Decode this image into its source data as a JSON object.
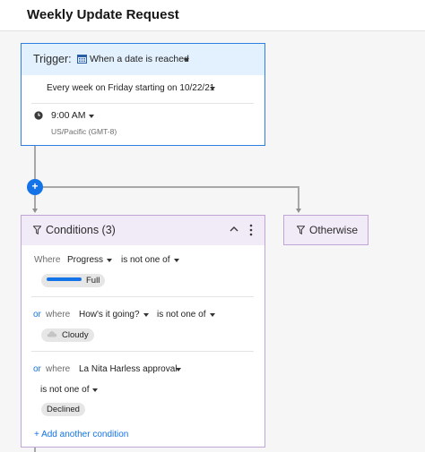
{
  "page": {
    "title": "Weekly Update Request"
  },
  "trigger": {
    "label": "Trigger:",
    "type_label": "When a date is reached",
    "type_icon": "calendar-icon",
    "schedule": "Every week on Friday starting on 10/22/21",
    "time": "9:00 AM",
    "time_icon": "clock-icon",
    "timezone": "US/Pacific (GMT-8)"
  },
  "add_button": {
    "label": "+"
  },
  "conditions": {
    "title": "Conditions (3)",
    "rows": [
      {
        "connector": "",
        "where": "Where",
        "field": "Progress",
        "operator": "is not one of",
        "value": "Full"
      },
      {
        "connector": "or",
        "where": "where",
        "field": "How's it going?",
        "operator": "is not one of",
        "value": "Cloudy"
      },
      {
        "connector": "or",
        "where": "where",
        "field": "La Nita Harless approval",
        "operator": "is not one of",
        "value": "Declined"
      }
    ],
    "add_label": "+ Add another condition"
  },
  "otherwise": {
    "label": "Otherwise"
  },
  "colors": {
    "accent": "#1473e6",
    "trigger_border": "#2d7fe0",
    "trigger_header": "#e3f0fd",
    "conditions_border": "#bfa6d6",
    "conditions_header": "#f1eaf7",
    "progress_full": "#1473e6"
  }
}
